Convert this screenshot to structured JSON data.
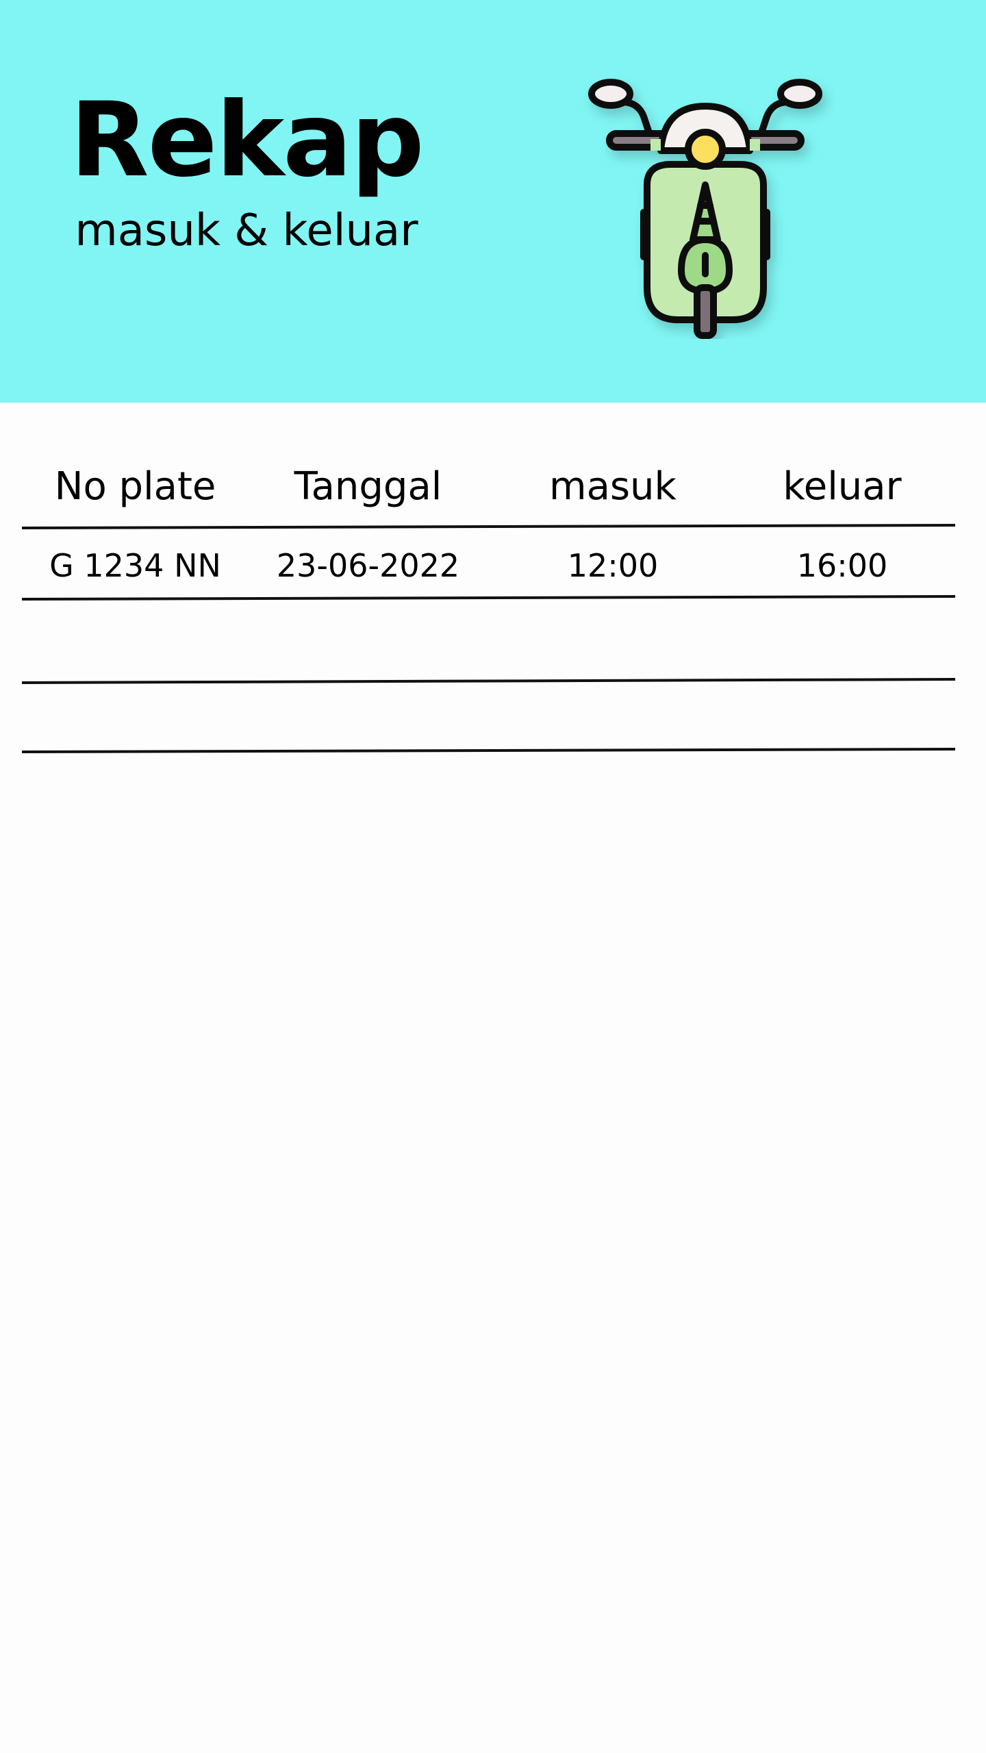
{
  "header": {
    "title": "Rekap",
    "subtitle": "masuk & keluar",
    "icon": "scooter-icon",
    "background_color": "#80f5f3"
  },
  "table": {
    "columns": [
      "No plate",
      "Tanggal",
      "masuk",
      "keluar"
    ],
    "rows": [
      {
        "plate": "G 1234 NN",
        "date": "23-06-2022",
        "in": "12:00",
        "out": "16:00"
      }
    ]
  }
}
